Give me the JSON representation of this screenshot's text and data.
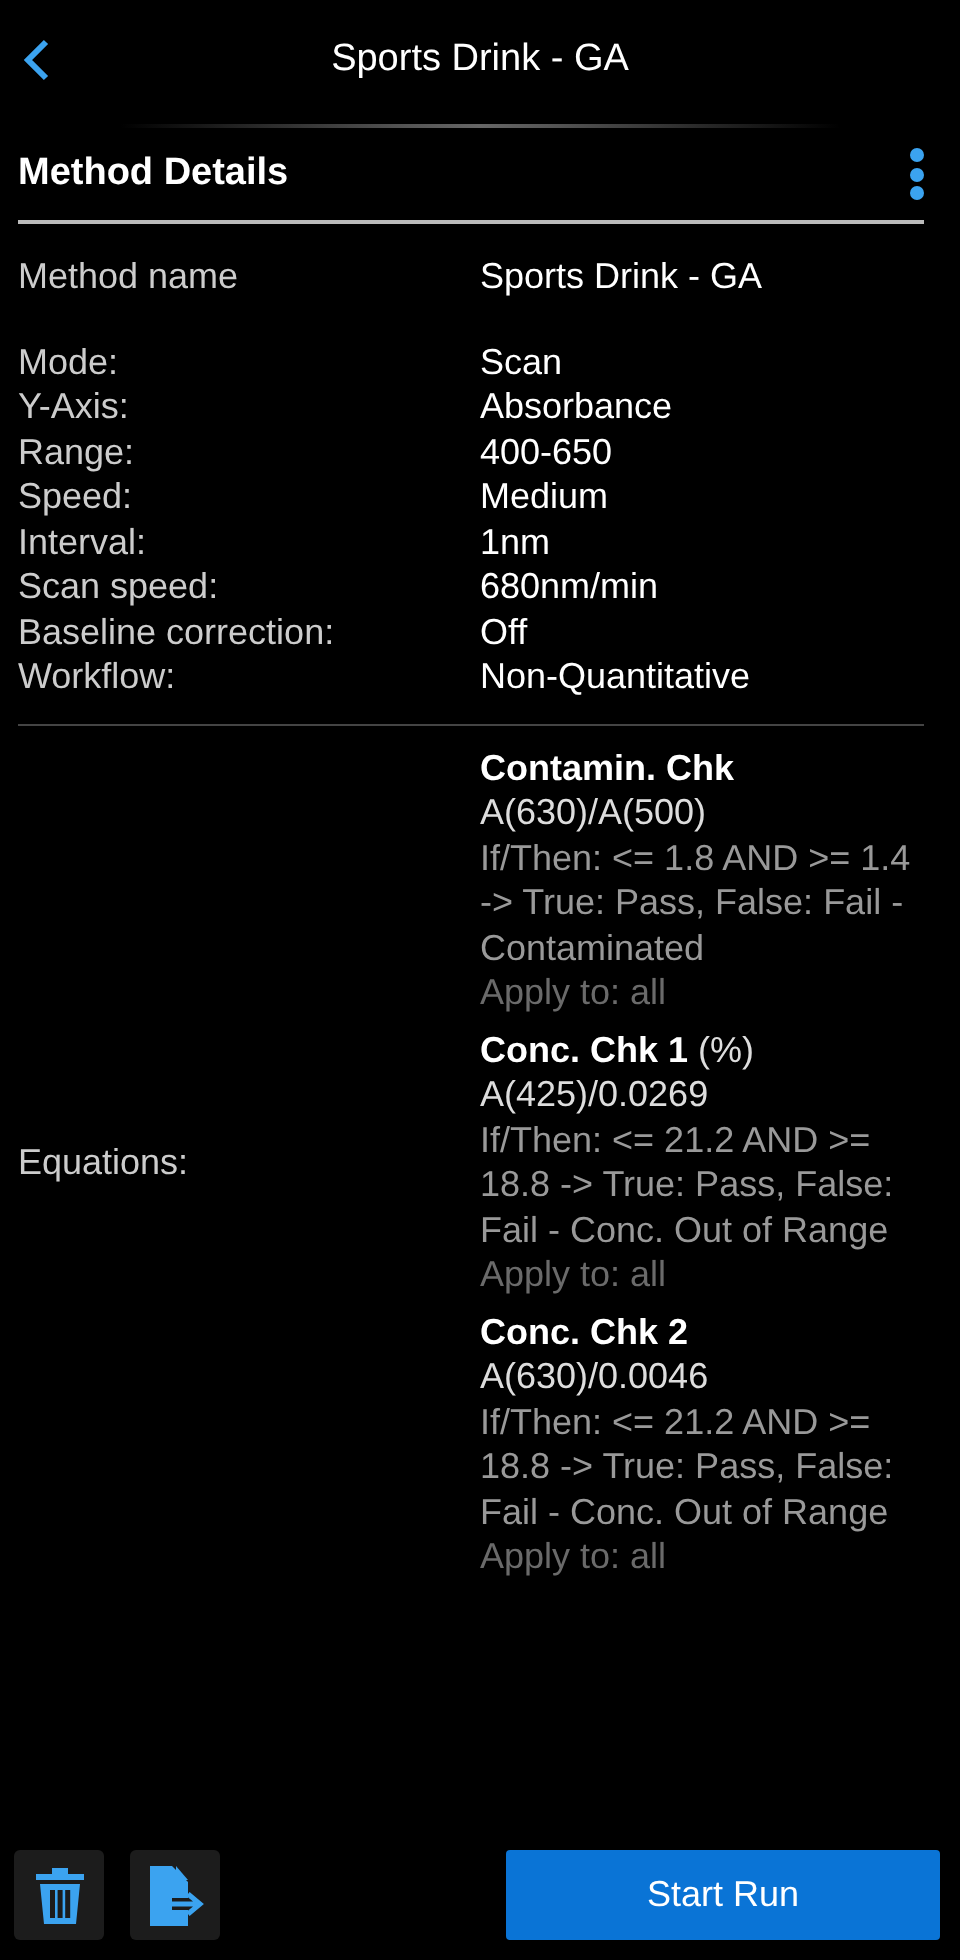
{
  "header": {
    "title": "Sports Drink - GA"
  },
  "section": {
    "title": "Method Details"
  },
  "method_name": {
    "label": "Method name",
    "value": "Sports Drink - GA"
  },
  "parameters": [
    {
      "label": "Mode:",
      "value": "Scan"
    },
    {
      "label": "Y-Axis:",
      "value": "Absorbance"
    },
    {
      "label": "Range:",
      "value": "400-650"
    },
    {
      "label": "Speed:",
      "value": "Medium"
    },
    {
      "label": "Interval:",
      "value": "1nm"
    },
    {
      "label": "Scan speed:",
      "value": "680nm/min"
    },
    {
      "label": "Baseline correction:",
      "value": "Off"
    },
    {
      "label": "Workflow:",
      "value": "Non-Quantitative"
    }
  ],
  "equations": {
    "label": "Equations:",
    "items": [
      {
        "name": "Contamin. Chk",
        "formula": "A(630)/A(500)",
        "condition": "If/Then: <= 1.8 AND >= 1.4 -> True: Pass, False: Fail - Contaminated",
        "apply_to": "Apply to: all"
      },
      {
        "name": "Conc. Chk 1",
        "unit": "(%)",
        "formula": "A(425)/0.0269",
        "condition": "If/Then: <= 21.2 AND >= 18.8 -> True: Pass, False: Fail - Conc. Out of Range",
        "apply_to": "Apply to: all"
      },
      {
        "name": "Conc. Chk 2",
        "formula": "A(630)/0.0046",
        "condition": "If/Then: <= 21.2 AND >= 18.8 -> True: Pass, False: Fail - Conc. Out of Range",
        "apply_to": "Apply to: all"
      }
    ]
  },
  "footer": {
    "primary_button": "Start Run"
  }
}
